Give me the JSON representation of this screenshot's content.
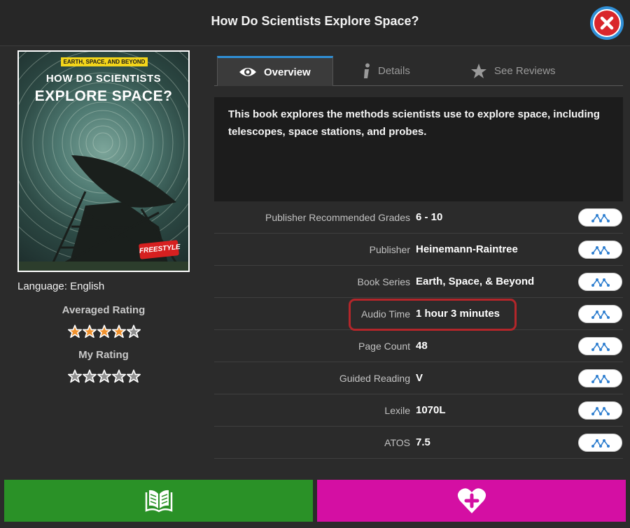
{
  "header": {
    "title": "How Do Scientists Explore Space?"
  },
  "cover": {
    "series_banner": "EARTH, SPACE, AND BEYOND",
    "title_line1": "HOW DO SCIENTISTS",
    "title_line2": "EXPLORE SPACE?",
    "brand": "FREESTYLE"
  },
  "language": "Language: English",
  "ratings": {
    "averaged_label": "Averaged Rating",
    "averaged_value": 4,
    "my_label": "My Rating",
    "my_value": 0,
    "max": 5
  },
  "tabs": [
    {
      "label": "Overview",
      "icon": "eye-icon",
      "active": true
    },
    {
      "label": "Details",
      "icon": "info-icon",
      "active": false
    },
    {
      "label": "See Reviews",
      "icon": "star-icon",
      "active": false
    }
  ],
  "description": "This book explores the methods scientists use to explore space, including telescopes, space stations, and probes.",
  "details": [
    {
      "label": "Publisher Recommended Grades",
      "value": "6 - 10"
    },
    {
      "label": "Publisher",
      "value": "Heinemann-Raintree"
    },
    {
      "label": "Book Series",
      "value": "Earth, Space, & Beyond"
    },
    {
      "label": "Audio Time",
      "value": "1 hour 3 minutes"
    },
    {
      "label": "Page Count",
      "value": "48"
    },
    {
      "label": "Guided Reading",
      "value": "V"
    },
    {
      "label": "Lexile",
      "value": "1070L"
    },
    {
      "label": "ATOS",
      "value": "7.5"
    }
  ],
  "colors": {
    "accent": "#2f8fd6",
    "read_button": "#2a9127",
    "favorite_button": "#d40fa3",
    "close": "#d9262b",
    "highlight": "#b3262a"
  },
  "footer": {
    "left_icon": "open-book-icon",
    "right_icon": "heart-plus-icon"
  }
}
